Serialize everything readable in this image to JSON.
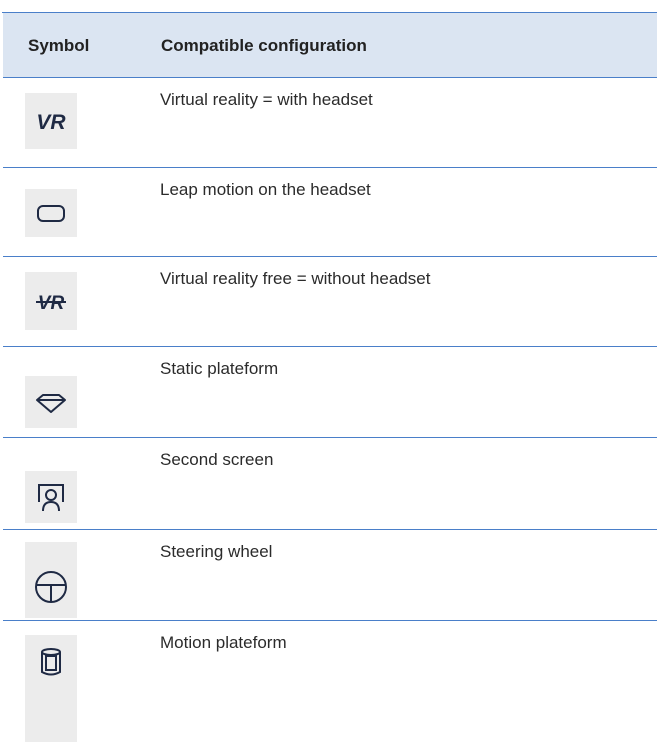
{
  "table": {
    "headers": {
      "symbol": "Symbol",
      "configuration": "Compatible configuration"
    },
    "rows": [
      {
        "icon": "vr-icon",
        "label": "Virtual reality = with headset"
      },
      {
        "icon": "leap-motion-icon",
        "label": "Leap motion on the headset"
      },
      {
        "icon": "vr-free-icon",
        "label": "Virtual reality free = without headset"
      },
      {
        "icon": "static-platform-icon",
        "label": "Static plateform"
      },
      {
        "icon": "second-screen-icon",
        "label": "Second screen"
      },
      {
        "icon": "steering-wheel-icon",
        "label": "Steering wheel"
      },
      {
        "icon": "motion-platform-icon",
        "label": "Motion plateform"
      }
    ],
    "icon_text": {
      "vr": "VR",
      "vr_free": "VR"
    }
  },
  "colors": {
    "border": "#4a7fc9",
    "header_bg": "#dbe5f2",
    "icon_bg": "#ececec"
  }
}
